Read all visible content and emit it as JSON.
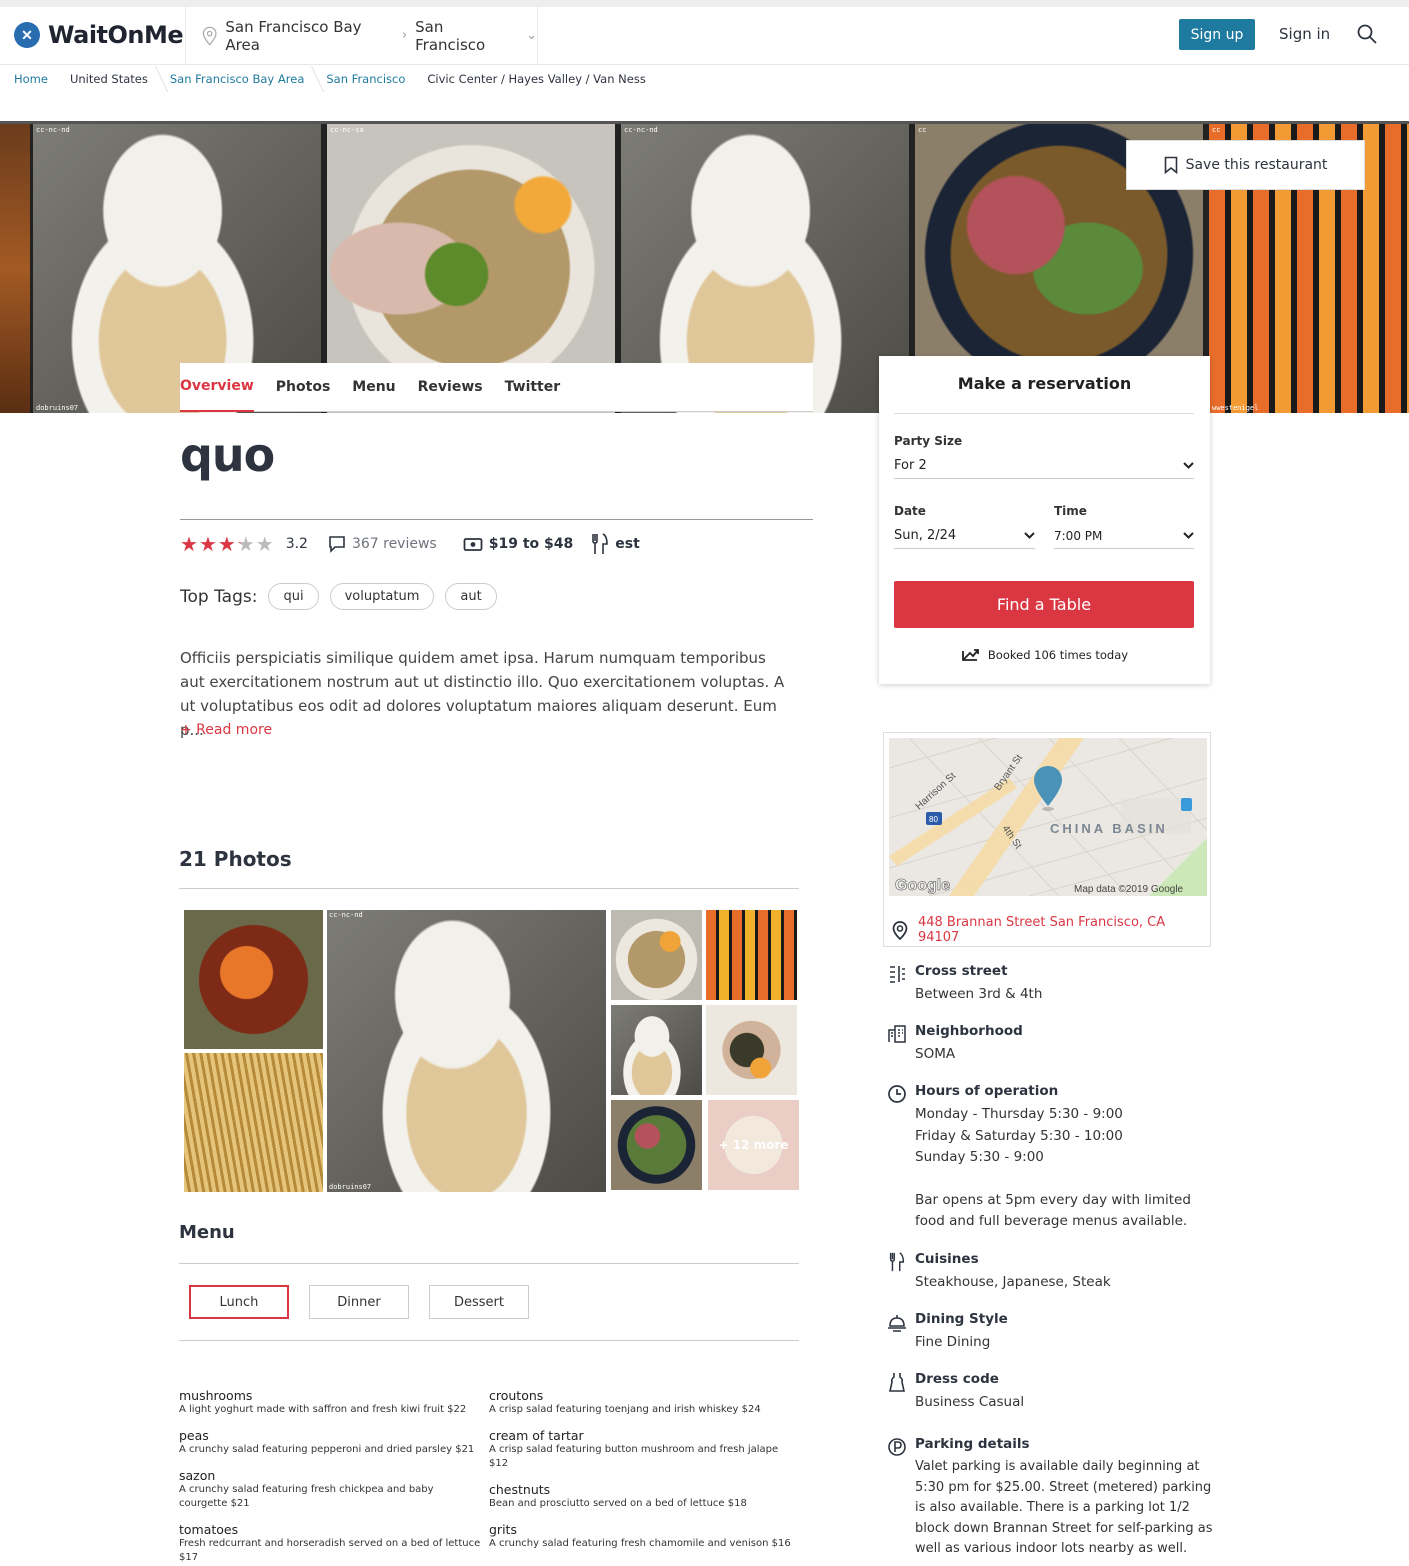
{
  "app": {
    "name": "WaitOnMe"
  },
  "header": {
    "location_region": "San Francisco Bay Area",
    "location_city": "San Francisco",
    "signup_label": "Sign up",
    "signin_label": "Sign in"
  },
  "breadcrumb": [
    "Home",
    "United States",
    "San Francisco Bay Area",
    "San Francisco",
    "Civic Center / Hayes Valley / Van Ness"
  ],
  "gallery": {
    "save_label": "Save this restaurant",
    "photos": [
      {
        "tag": "cc-nc-nd",
        "credit": "dobruins07"
      },
      {
        "tag": "cc-nc-sa",
        "credit": ""
      },
      {
        "tag": "cc-nc-nd",
        "credit": ""
      },
      {
        "tag": "cc",
        "credit": ""
      },
      {
        "tag": "cc",
        "credit": "wwestenigel"
      }
    ]
  },
  "tabs": [
    "Overview",
    "Photos",
    "Menu",
    "Reviews",
    "Twitter"
  ],
  "restaurant": {
    "name": "quo",
    "rating": "3.2",
    "rating_value": 3.2,
    "reviews": "367 reviews",
    "price": "$19 to $48",
    "cuisine_short": "est",
    "top_tags_label": "Top Tags:",
    "top_tags": [
      "qui",
      "voluptatum",
      "aut"
    ],
    "description": "Officiis perspiciatis similique quidem amet ipsa. Harum numquam temporibus aut exercitationem nostrum aut ut distinctio illo. Quo exercitationem voluptas. A ut voluptatibus eos odit ad dolores voluptatum maiores aliquam deserunt. Eum p...",
    "read_more": "+ Read more"
  },
  "photos_section": {
    "title": "21 Photos",
    "more_label": "+ 12 more",
    "main_tag": "cc-nc-nd",
    "main_credit": "dobruins07"
  },
  "menu": {
    "title": "Menu",
    "tabs": [
      "Lunch",
      "Dinner",
      "Dessert"
    ],
    "left": [
      {
        "name": "mushrooms",
        "desc": "A light yoghurt made with saffron and fresh kiwi fruit $22"
      },
      {
        "name": "peas",
        "desc": "A crunchy salad featuring pepperoni and dried parsley $21"
      },
      {
        "name": "sazon",
        "desc": "A crunchy salad featuring fresh chickpea and baby courgette $21"
      },
      {
        "name": "tomatoes",
        "desc": "Fresh redcurrant and horseradish served on a bed of lettuce $17"
      }
    ],
    "right": [
      {
        "name": "croutons",
        "desc": "A crisp salad featuring toenjang and irish whiskey $24"
      },
      {
        "name": "cream of tartar",
        "desc": "A crisp salad featuring button mushroom and fresh jalape $12"
      },
      {
        "name": "chestnuts",
        "desc": "Bean and prosciutto served on a bed of lettuce $18"
      },
      {
        "name": "grits",
        "desc": "A crunchy salad featuring fresh chamomile and venison $16"
      }
    ]
  },
  "reservation": {
    "title": "Make a reservation",
    "party_label": "Party Size",
    "party_value": "For 2",
    "date_label": "Date",
    "date_value": "Sun, 2/24",
    "time_label": "Time",
    "time_value": "7:00 PM",
    "find_label": "Find a Table",
    "booked": "Booked 106 times today"
  },
  "map": {
    "labels": {
      "harrison": "Harrison St",
      "bryant": "Bryant St",
      "fourth": "4th St",
      "basin": "CHINA BASIN",
      "interstate": "80",
      "attribution": "Map data ©2019 Google",
      "google": "Google"
    },
    "address": "448 Brannan Street San Francisco, CA 94107"
  },
  "details": {
    "cross_label": "Cross street",
    "cross_value": "Between 3rd & 4th",
    "neighborhood_label": "Neighborhood",
    "neighborhood_value": "SOMA",
    "hours_label": "Hours of operation",
    "hours": [
      "Monday - Thursday 5:30 - 9:00",
      "Friday & Saturday 5:30 - 10:00",
      "Sunday 5:30 - 9:00"
    ],
    "hours_note": "Bar opens at 5pm every day with limited food and full beverage menus available.",
    "cuisines_label": "Cuisines",
    "cuisines_value": "Steakhouse, Japanese, Steak",
    "dining_label": "Dining Style",
    "dining_value": "Fine Dining",
    "dress_label": "Dress code",
    "dress_value": "Business Casual",
    "parking_label": "Parking details",
    "parking_value": "Valet parking is available daily beginning at 5:30 pm for $25.00. Street (metered) parking is also available. There is a parking lot 1/2 block down Brannan Street for self-parking as well as various indoor lots nearby as well."
  },
  "colors": {
    "accent": "#da3743",
    "brand": "#1f7aa0",
    "logo": "#2a6cb0",
    "star_filled": "#da3743",
    "star_empty": "#bbbbbb"
  }
}
